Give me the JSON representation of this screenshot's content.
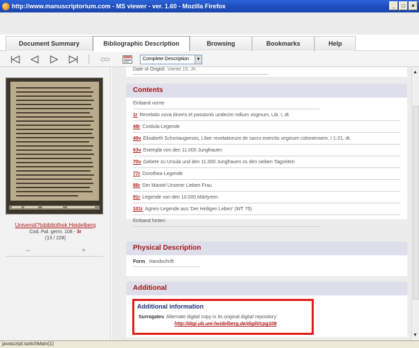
{
  "window": {
    "title": "http://www.manuscriptorium.com - MS viewer - ver. 1.60 - Mozilla Firefox",
    "controls": [
      "_",
      "□",
      "×"
    ]
  },
  "tabs": [
    {
      "label": "Document Summary",
      "active": false
    },
    {
      "label": "Bibliographic Description",
      "active": true
    },
    {
      "label": "Browsing",
      "active": false
    },
    {
      "label": "Bookmarks",
      "active": false
    },
    {
      "label": "Help",
      "active": false
    }
  ],
  "toolbar": {
    "icons": [
      "first-page-icon",
      "previous-page-icon",
      "next-page-icon",
      "last-page-icon",
      "link-icon",
      "description-view-icon"
    ],
    "view_select": "Complete Description"
  },
  "left_panel": {
    "library": "Universit?tsbibliothek Heidelberg",
    "shelfmark_prefix": "Cod. Pal. germ. 108 - ",
    "shelfmark_folio": "3r",
    "page_count": "(13 / 228)",
    "zoom_out": "–",
    "zoom_in": "+"
  },
  "main": {
    "date_of_origin": {
      "label": "Date of Origin",
      "value": "3. Viertel 15. Jh."
    },
    "contents": {
      "heading": "Contents",
      "entries": [
        {
          "folio": "",
          "text": "Einband vorne"
        },
        {
          "folio": "1r",
          "text": "Revelatio nova itineris et passionis undecim milium virginum, Lib. I, dt."
        },
        {
          "folio": "48r",
          "text": "Cordula-Legende"
        },
        {
          "folio": "49v",
          "text": "Elisabeth Schonaugiensis, Liber revelationum de sacro exercitu virginum coloniensem, I 1-21, dt."
        },
        {
          "folio": "63v",
          "text": "Exempla von den 11.000 Jungfrauen"
        },
        {
          "folio": "70v",
          "text": "Gebete zu Ursula und den 11.000 Jungfrauen zu den sieben Tagzeiten"
        },
        {
          "folio": "77r",
          "text": "Dorothea-Legende"
        },
        {
          "folio": "86r",
          "text": "Der Mantel Unserer Lieben Frau"
        },
        {
          "folio": "91r",
          "text": "Legende von den 10.000 Märtyrern"
        },
        {
          "folio": "101r",
          "text": "Agnes-Legende aus 'Der Heiligen Leben' (WT 75)"
        },
        {
          "folio": "",
          "text": "Einband hinten"
        }
      ]
    },
    "physical": {
      "heading": "Physical Description",
      "label": "Form",
      "value": "Handschrift"
    },
    "additional": {
      "heading": "Additional",
      "box_title": "Additional information",
      "surrogates_label": "Surrogates",
      "surrogates_text": "Alternate digital copy in its original digital repository:",
      "surrogates_link": "http://digi.ub.uni-heidelberg.de/diglit/cpg108"
    }
  },
  "statusbar": {
    "text": "javascript:switchMain(1)"
  },
  "colors": {
    "accent_red": "#b01818",
    "header_band": "#dedfeb",
    "highlight_box": "#e41b1b",
    "titlebar_blue": "#1f4fbf"
  }
}
